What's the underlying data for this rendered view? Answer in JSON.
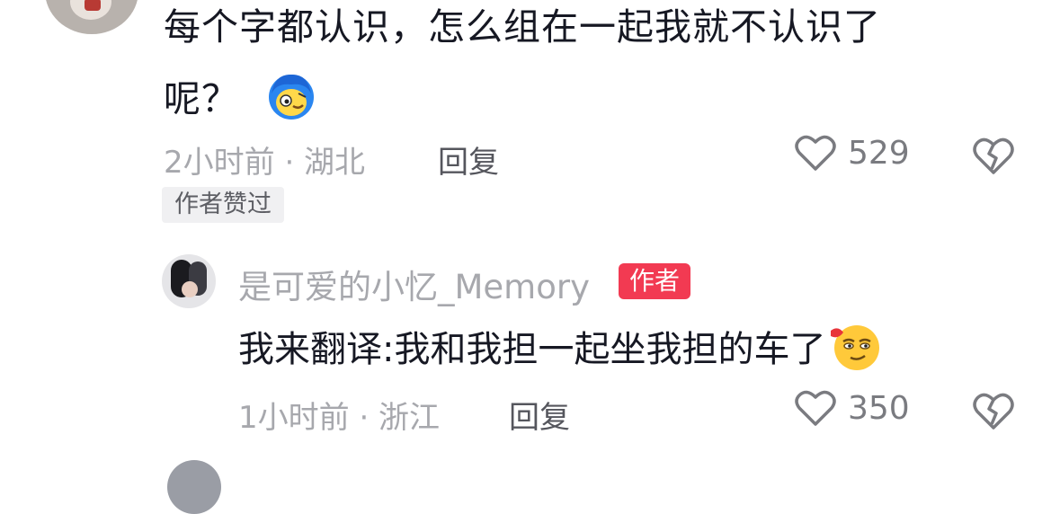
{
  "comment": {
    "text_line1": "每个字都认识，怎么组在一起我就不认识了",
    "text_line2": "呢？",
    "emoji": "emoji-face",
    "meta": "2小时前 · 湖北",
    "reply_label": "回复",
    "likes": "529",
    "badge": "作者赞过"
  },
  "reply": {
    "username": "是可爱的小忆_Memory",
    "author_badge": "作者",
    "text": "我来翻译:我和我担一起坐我担的车了",
    "emoji": "emoji-sly-smile",
    "meta": "1小时前 · 浙江",
    "reply_label": "回复",
    "likes": "350"
  },
  "colors": {
    "primary_text": "#161823",
    "secondary_text": "#a7a8ad",
    "author_badge_bg": "#f23a52"
  }
}
